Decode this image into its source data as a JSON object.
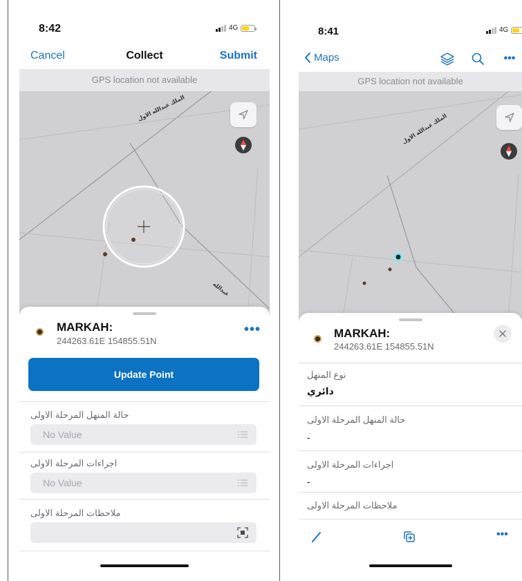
{
  "left_screen": {
    "status": {
      "time": "8:42",
      "network": "4G"
    },
    "nav": {
      "cancel_label": "Cancel",
      "title": "Collect",
      "submit_label": "Submit"
    },
    "gps_banner": "GPS location not available",
    "map": {
      "street_label_1": "الملك عبدالله الاول",
      "street_label_2": "عبدالله"
    },
    "feature": {
      "title": "MARKAH:",
      "coords": "244263.61E 154855.51N"
    },
    "update_button_label": "Update Point",
    "fields": [
      {
        "label": "حالة المنهل المرحلة الاولى",
        "placeholder": "No Value"
      },
      {
        "label": "اجراءات المرحلة الاولى",
        "placeholder": "No Value"
      },
      {
        "label": "ملاحظات المرحلة الاولى",
        "placeholder": ""
      }
    ]
  },
  "right_screen": {
    "status": {
      "time": "8:41",
      "network": "4G"
    },
    "nav": {
      "back_label": "Maps"
    },
    "gps_banner": "GPS location not available",
    "map": {
      "street_label_1": "الملك عبدالله الاول"
    },
    "feature": {
      "title": "MARKAH:",
      "coords": "244263.61E 154855.51N"
    },
    "attributes": [
      {
        "label": "نوع المنهل",
        "value": "دائري"
      },
      {
        "label": "حالة المنهل المرحلة الاولى",
        "value": "-"
      },
      {
        "label": "اجراءات المرحلة الاولى",
        "value": "-"
      },
      {
        "label": "ملاحظات المرحلة الاولى",
        "value": ""
      }
    ]
  },
  "colors": {
    "accent_blue": "#1a73c9",
    "button_blue": "#0b72c4",
    "map_gray": "#d0d0d2",
    "banner_gray": "#e7e7e9",
    "battery_yellow": "#ffd60a",
    "selection_cyan": "#35d6e6"
  },
  "icons": {
    "left_map_locate": "location-arrow-icon",
    "left_map_compass": "compass-icon",
    "left_field_list_1": "list-icon",
    "left_field_list_2": "list-icon",
    "left_field_scan": "scan-icon",
    "right_nav_layers": "layers-icon",
    "right_nav_search": "search-icon",
    "right_nav_more": "more-icon",
    "right_close": "close-icon",
    "right_edit": "pencil-icon",
    "right_copy": "copy-add-icon"
  }
}
